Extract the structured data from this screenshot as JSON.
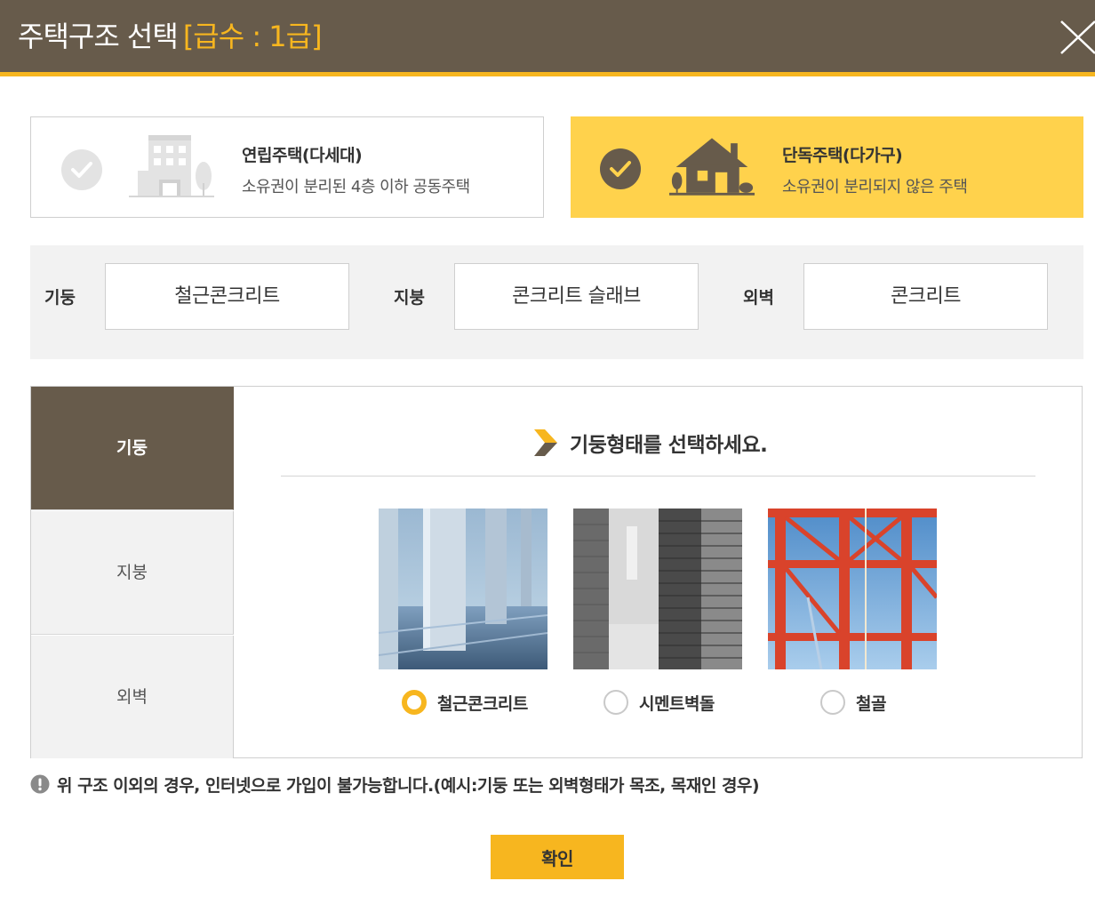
{
  "header": {
    "title": "주택구조 선택",
    "grade": "[급수 : 1급]",
    "close_icon": "close-icon"
  },
  "house_types": [
    {
      "name": "연립주택(다세대)",
      "desc": "소유권이 분리된 4층 이하 공동주택",
      "selected": false
    },
    {
      "name": "단독주택(다가구)",
      "desc": "소유권이 분리되지 않은 주택",
      "selected": true
    }
  ],
  "summary": {
    "pillar_label": "기둥",
    "pillar_value": "철근콘크리트",
    "roof_label": "지붕",
    "roof_value": "콘크리트 슬래브",
    "wall_label": "외벽",
    "wall_value": "콘크리트"
  },
  "tabs": [
    {
      "label": "기둥",
      "active": true
    },
    {
      "label": "지붕",
      "active": false
    },
    {
      "label": "외벽",
      "active": false
    }
  ],
  "question": "기둥형태를 선택하세요.",
  "options": [
    {
      "label": "철근콘크리트",
      "selected": true
    },
    {
      "label": "시멘트벽돌",
      "selected": false
    },
    {
      "label": "철골",
      "selected": false
    }
  ],
  "notice": "위 구조 이외의 경우, 인터넷으로 가입이 불가능합니다.(예시:기둥 또는 외벽형태가 목조, 목재인 경우)",
  "confirm_label": "확인",
  "colors": {
    "header_bg": "#675b4b",
    "accent": "#f7b61f",
    "selected_card": "#ffd24c"
  }
}
